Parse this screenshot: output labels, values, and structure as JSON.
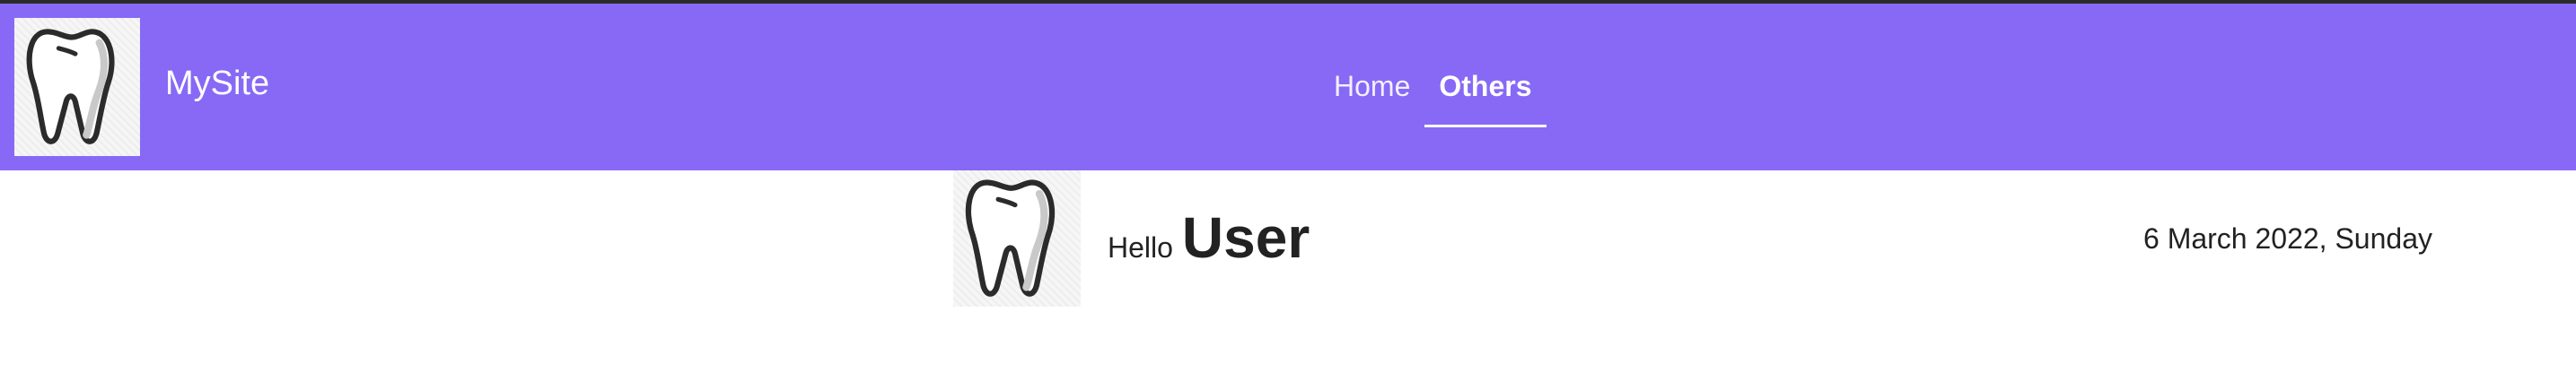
{
  "site": {
    "name": "MySite",
    "logo_icon": "tooth-icon"
  },
  "nav": {
    "items": [
      {
        "label": "Home",
        "active": false
      },
      {
        "label": "Others",
        "active": true
      }
    ]
  },
  "main": {
    "avatar_icon": "tooth-icon",
    "greeting_hello": "Hello",
    "greeting_user": "User",
    "date": "6 March 2022, Sunday"
  },
  "colors": {
    "header_bg": "#8769f6",
    "top_border": "#2a2a2a",
    "nav_text": "#ffffff",
    "body_text": "#222222"
  }
}
